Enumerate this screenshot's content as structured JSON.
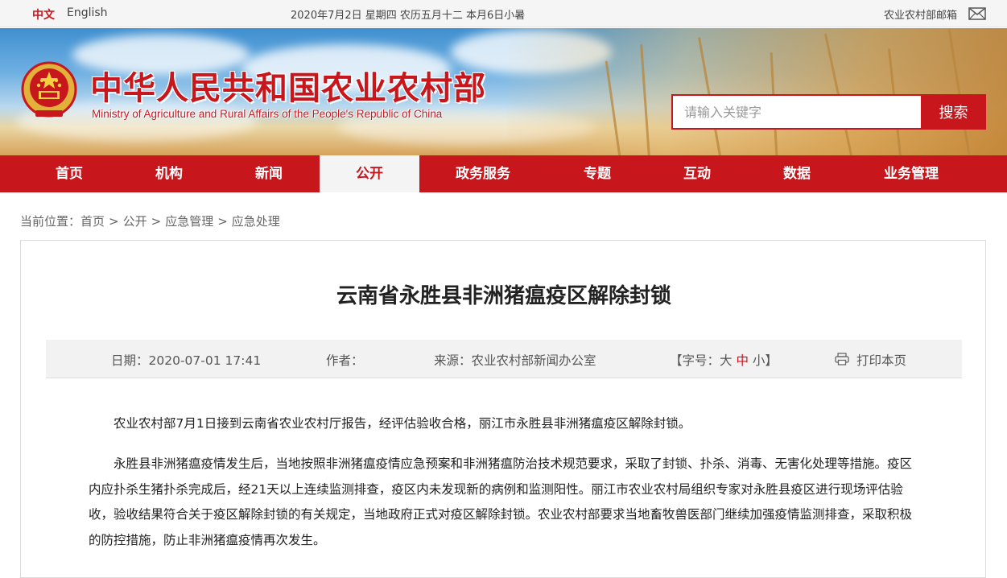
{
  "topbar": {
    "lang_zh": "中文",
    "lang_en": "English",
    "date": "2020年7月2日  星期四  农历五月十二  本月6日小暑",
    "mailbox": "农业农村部邮箱"
  },
  "header": {
    "ministry_cn": "中华人民共和国农业农村部",
    "ministry_en": "Ministry of Agriculture and Rural Affairs of the People's Republic of China",
    "search_placeholder": "请输入关键字",
    "search_button": "搜索"
  },
  "nav": {
    "items": [
      {
        "label": "首页"
      },
      {
        "label": "机构"
      },
      {
        "label": "新闻"
      },
      {
        "label": "公开",
        "active": true
      },
      {
        "label": "政务服务"
      },
      {
        "label": "专题"
      },
      {
        "label": "互动"
      },
      {
        "label": "数据"
      },
      {
        "label": "业务管理"
      }
    ]
  },
  "breadcrumb": {
    "prefix": "当前位置：",
    "items": [
      "首页",
      "公开",
      "应急管理",
      "应急处理"
    ],
    "separator": ">"
  },
  "article": {
    "title": "云南省永胜县非洲猪瘟疫区解除封锁",
    "date": "日期：2020-07-01 17:41",
    "author": "作者：",
    "source": "来源：农业农村部新闻办公室",
    "fontsize_prefix": "【字号：",
    "fontsize_large": "大",
    "fontsize_medium": "中",
    "fontsize_small": "小",
    "fontsize_suffix": "】",
    "print": "打印本页",
    "paragraphs": [
      "农业农村部7月1日接到云南省农业农村厅报告，经评估验收合格，丽江市永胜县非洲猪瘟疫区解除封锁。",
      "永胜县非洲猪瘟疫情发生后，当地按照非洲猪瘟疫情应急预案和非洲猪瘟防治技术规范要求，采取了封锁、扑杀、消毒、无害化处理等措施。疫区内应扑杀生猪扑杀完成后，经21天以上连续监测排查，疫区内未发现新的病例和监测阳性。丽江市农业农村局组织专家对永胜县疫区进行现场评估验收，验收结果符合关于疫区解除封锁的有关规定，当地政府正式对疫区解除封锁。农业农村部要求当地畜牧兽医部门继续加强疫情监测排查，采取积极的防控措施，防止非洲猪瘟疫情再次发生。"
    ]
  },
  "colors": {
    "brand_red": "#c8161d",
    "topbar_bg": "#f5f5f5",
    "meta_bg": "#f2f2f2"
  },
  "icons": {
    "mail": "mail-icon",
    "print": "print-icon",
    "emblem": "national-emblem-icon"
  }
}
